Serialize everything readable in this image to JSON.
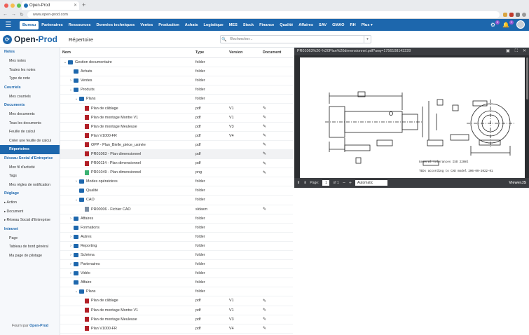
{
  "browser": {
    "tab_title": "Open-Prod",
    "url": "www.open-prod.com"
  },
  "topnav": {
    "items": [
      {
        "label": "Bureau",
        "active": true
      },
      {
        "label": "Partenaires"
      },
      {
        "label": "Ressources"
      },
      {
        "label": "Données techniques"
      },
      {
        "label": "Ventes"
      },
      {
        "label": "Production"
      },
      {
        "label": "Achats"
      },
      {
        "label": "Logistique"
      },
      {
        "label": "MES"
      },
      {
        "label": "Stock"
      },
      {
        "label": "Finance"
      },
      {
        "label": "Qualité"
      },
      {
        "label": "Affaires"
      },
      {
        "label": "SAV"
      },
      {
        "label": "GMAO"
      },
      {
        "label": "RH"
      },
      {
        "label": "Plus ▾"
      }
    ],
    "badge_1": "3",
    "badge_2": "2"
  },
  "header": {
    "logo_text_1": "Open-",
    "logo_text_2": "Prod",
    "page_title": "Répertoire",
    "search_placeholder": "Rechercher..."
  },
  "sidebar": {
    "sections": [
      {
        "title": "Notes",
        "items": [
          {
            "label": "Mes notes"
          },
          {
            "label": "Toutes les notes"
          },
          {
            "label": "Type de note"
          }
        ]
      },
      {
        "title": "Courriels",
        "items": [
          {
            "label": "Mes courriels"
          }
        ]
      },
      {
        "title": "Documents",
        "items": [
          {
            "label": "Mes documents"
          },
          {
            "label": "Tous les documents"
          },
          {
            "label": "Feuille de calcul"
          },
          {
            "label": "Créer une feuille de calcul"
          },
          {
            "label": "Répertoires",
            "active": true
          }
        ]
      },
      {
        "title": "Réseau Social d'Entreprise",
        "items": [
          {
            "label": "Mon fil d'activité"
          },
          {
            "label": "Tags"
          },
          {
            "label": "Mes règles de notification"
          }
        ]
      },
      {
        "title": "Réglage",
        "items": [
          {
            "label": "Action",
            "tri": true
          },
          {
            "label": "Document",
            "tri": true
          },
          {
            "label": "Réseau Social d'Entreprise",
            "tri": true
          }
        ]
      },
      {
        "title": "Intranet",
        "items": [
          {
            "label": "Page"
          },
          {
            "label": "Tableau de bord général"
          },
          {
            "label": "Ma page de pilotage"
          }
        ]
      }
    ],
    "footer_prefix": "Fourni par",
    "footer_brand": "Open-Prod"
  },
  "table": {
    "headers": {
      "name": "Nom",
      "type": "Type",
      "version": "Version",
      "document": "Document"
    },
    "rows": [
      {
        "name": "Gestion documentaire",
        "type": "folder",
        "version": "",
        "doc": false,
        "depth": 0,
        "chev": "v",
        "icon": "folder"
      },
      {
        "name": "Achats",
        "type": "folder",
        "version": "",
        "doc": false,
        "depth": 1,
        "chev": "",
        "icon": "folder"
      },
      {
        "name": "Ventes",
        "type": "folder",
        "version": "",
        "doc": false,
        "depth": 1,
        "chev": ">",
        "icon": "folder"
      },
      {
        "name": "Produits",
        "type": "folder",
        "version": "",
        "doc": false,
        "depth": 1,
        "chev": "v",
        "icon": "folder"
      },
      {
        "name": "Plans",
        "type": "folder",
        "version": "",
        "doc": false,
        "depth": 2,
        "chev": "v",
        "icon": "folder"
      },
      {
        "name": "Plan de câblage",
        "type": "pdf",
        "version": "V1",
        "doc": true,
        "depth": 3,
        "chev": "",
        "icon": "pdf"
      },
      {
        "name": "Plan de montage Montre V1",
        "type": "pdf",
        "version": "V1",
        "doc": true,
        "depth": 3,
        "chev": "",
        "icon": "pdf"
      },
      {
        "name": "Plan de montage Meuleuse",
        "type": "pdf",
        "version": "V3",
        "doc": true,
        "depth": 3,
        "chev": "",
        "icon": "pdf"
      },
      {
        "name": "Plan V1000-FR",
        "type": "pdf",
        "version": "V4",
        "doc": true,
        "depth": 3,
        "chev": "",
        "icon": "pdf"
      },
      {
        "name": "OPP - Plan_Bielle_pièce_usinée",
        "type": "pdf",
        "version": "",
        "doc": true,
        "depth": 3,
        "chev": "",
        "icon": "pdf"
      },
      {
        "name": "PR01063 - Plan dimensionnel",
        "type": "pdf",
        "version": "",
        "doc": true,
        "depth": 3,
        "chev": "",
        "icon": "pdf",
        "highlight": true
      },
      {
        "name": "PR00114 - Plan dimensionnel",
        "type": "pdf",
        "version": "",
        "doc": true,
        "depth": 3,
        "chev": "",
        "icon": "pdf"
      },
      {
        "name": "PR01049 - Plan dimensionnel",
        "type": "png",
        "version": "",
        "doc": true,
        "depth": 3,
        "chev": "",
        "icon": "png"
      },
      {
        "name": "Modes opératoires",
        "type": "folder",
        "version": "",
        "doc": false,
        "depth": 2,
        "chev": ">",
        "icon": "folder"
      },
      {
        "name": "Qualité",
        "type": "folder",
        "version": "",
        "doc": false,
        "depth": 2,
        "chev": "",
        "icon": "folder"
      },
      {
        "name": "CAO",
        "type": "folder",
        "version": "",
        "doc": false,
        "depth": 2,
        "chev": "v",
        "icon": "folder"
      },
      {
        "name": "PR00006 - Fichier CAO",
        "type": "sldasm",
        "version": "",
        "doc": true,
        "depth": 3,
        "chev": "",
        "icon": "cad"
      },
      {
        "name": "Affaires",
        "type": "folder",
        "version": "",
        "doc": false,
        "depth": 1,
        "chev": ">",
        "icon": "folder"
      },
      {
        "name": "Formations",
        "type": "folder",
        "version": "",
        "doc": false,
        "depth": 1,
        "chev": "",
        "icon": "folder"
      },
      {
        "name": "Autres",
        "type": "folder",
        "version": "",
        "doc": false,
        "depth": 1,
        "chev": ">",
        "icon": "folder"
      },
      {
        "name": "Reporting",
        "type": "folder",
        "version": "",
        "doc": false,
        "depth": 1,
        "chev": ">",
        "icon": "folder"
      },
      {
        "name": "Schéma",
        "type": "folder",
        "version": "",
        "doc": false,
        "depth": 1,
        "chev": ">",
        "icon": "folder"
      },
      {
        "name": "Partenaires",
        "type": "folder",
        "version": "",
        "doc": false,
        "depth": 1,
        "chev": ">",
        "icon": "folder"
      },
      {
        "name": "Vidéo",
        "type": "folder",
        "version": "",
        "doc": false,
        "depth": 1,
        "chev": ">",
        "icon": "folder"
      },
      {
        "name": "Affaire",
        "type": "folder",
        "version": "",
        "doc": false,
        "depth": 1,
        "chev": "",
        "icon": "folder"
      },
      {
        "name": "Plans",
        "type": "folder",
        "version": "",
        "doc": false,
        "depth": 2,
        "chev": "v",
        "icon": "folder"
      },
      {
        "name": "Plan de câblage",
        "type": "pdf",
        "version": "V1",
        "doc": true,
        "depth": 3,
        "chev": "",
        "icon": "pdf"
      },
      {
        "name": "Plan de montage Montre V1",
        "type": "pdf",
        "version": "V1",
        "doc": true,
        "depth": 3,
        "chev": "",
        "icon": "pdf"
      },
      {
        "name": "Plan de montage Meuleuse",
        "type": "pdf",
        "version": "V3",
        "doc": true,
        "depth": 3,
        "chev": "",
        "icon": "pdf"
      },
      {
        "name": "Plan V1000-FR",
        "type": "pdf",
        "version": "V4",
        "doc": true,
        "depth": 3,
        "chev": "",
        "icon": "pdf"
      }
    ]
  },
  "viewer": {
    "filename": "PR01063%20-%20Plan%20dimensionnel.pdf?unq=1756108143228",
    "page_label": "Page:",
    "page_value": "1",
    "page_of": "of 1",
    "zoom": "Automatic",
    "brand": "ViewerJS",
    "drawing_note_1": "General tolerances ISO 2208l",
    "drawing_note_2": "TEDs according to CAD model 206-09-2022-01"
  },
  "colors": {
    "brand": "#1d67ad",
    "pdf": "#b21f27",
    "png": "#3bb273",
    "badge": "#9b57d3"
  }
}
